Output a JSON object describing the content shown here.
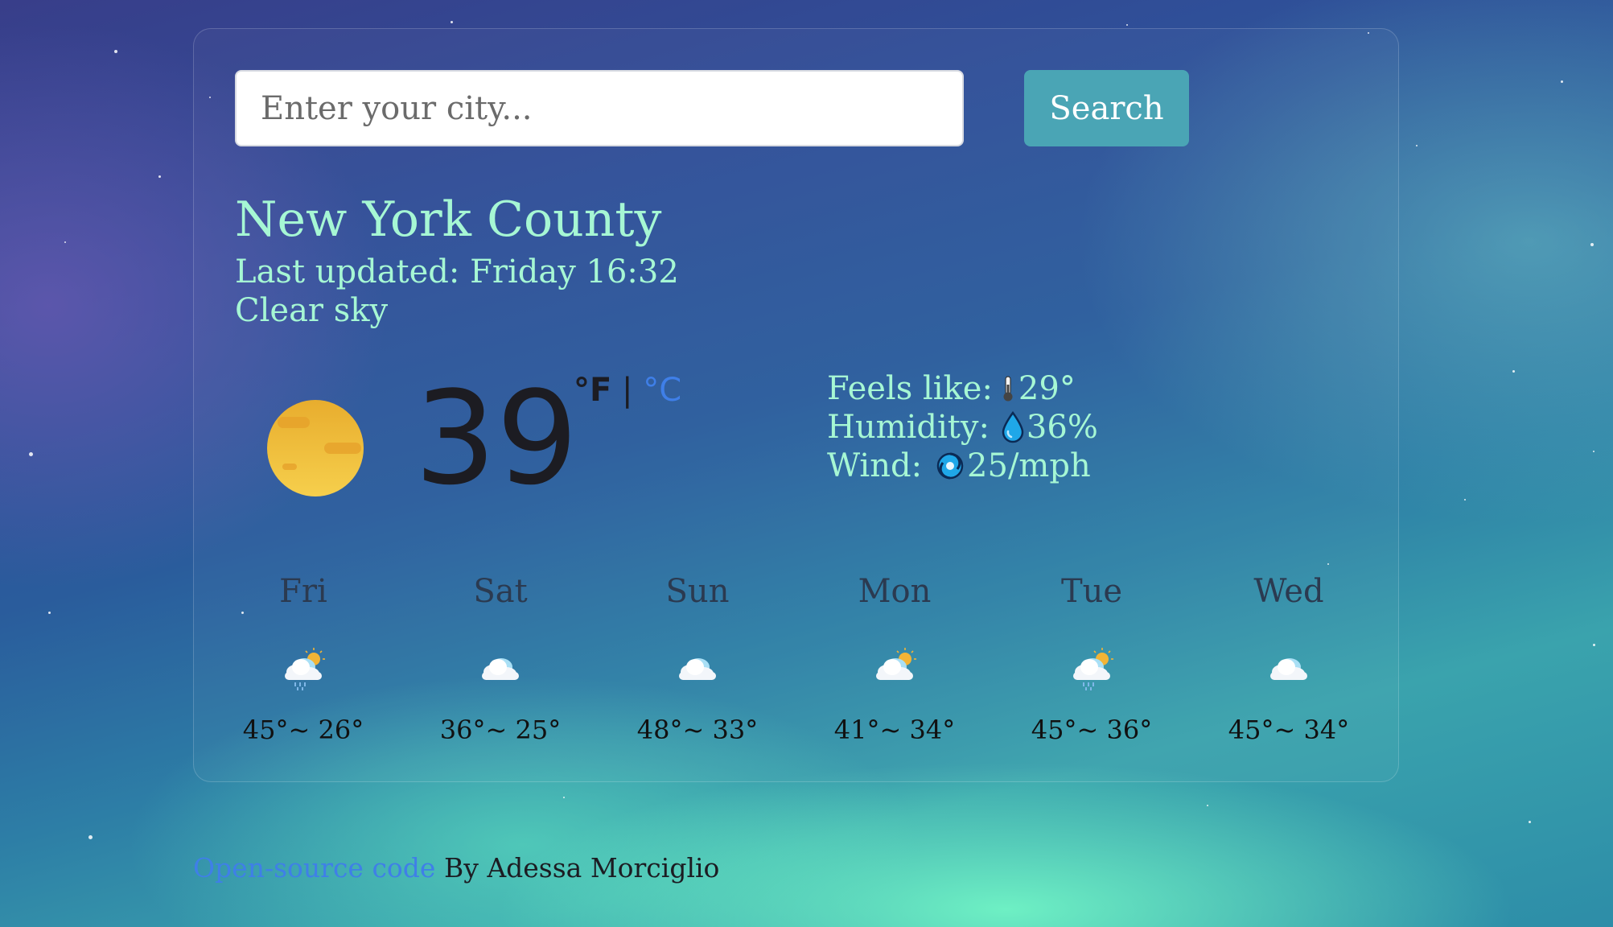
{
  "search": {
    "placeholder": "Enter your city...",
    "button_label": "Search"
  },
  "current": {
    "city": "New York County",
    "last_updated": "Last updated: Friday 16:32",
    "description": "Clear sky",
    "temperature": "39",
    "unit_f": "°F",
    "unit_separator": "|",
    "unit_c": "°C",
    "icon": "sun-icon",
    "feels_like_label": "Feels like:",
    "feels_like_value": "29°",
    "humidity_label": "Humidity:",
    "humidity_value": "36%",
    "wind_label": "Wind:",
    "wind_value": "25/mph"
  },
  "forecast": [
    {
      "day": "Fri",
      "temps": "45°~ 26°",
      "icon": "partly-cloudy-rain-icon"
    },
    {
      "day": "Sat",
      "temps": "36°~ 25°",
      "icon": "cloud-icon"
    },
    {
      "day": "Sun",
      "temps": "48°~ 33°",
      "icon": "cloud-icon"
    },
    {
      "day": "Mon",
      "temps": "41°~ 34°",
      "icon": "partly-cloudy-icon"
    },
    {
      "day": "Tue",
      "temps": "45°~ 36°",
      "icon": "partly-cloudy-rain-icon"
    },
    {
      "day": "Wed",
      "temps": "45°~ 34°",
      "icon": "cloud-icon"
    }
  ],
  "footer": {
    "link_text": "Open-source code",
    "author_text": " By Adessa Morciglio"
  },
  "colors": {
    "accent_text": "#a6f7d4",
    "link": "#3f7fe8",
    "button": "#4aa5b5"
  }
}
